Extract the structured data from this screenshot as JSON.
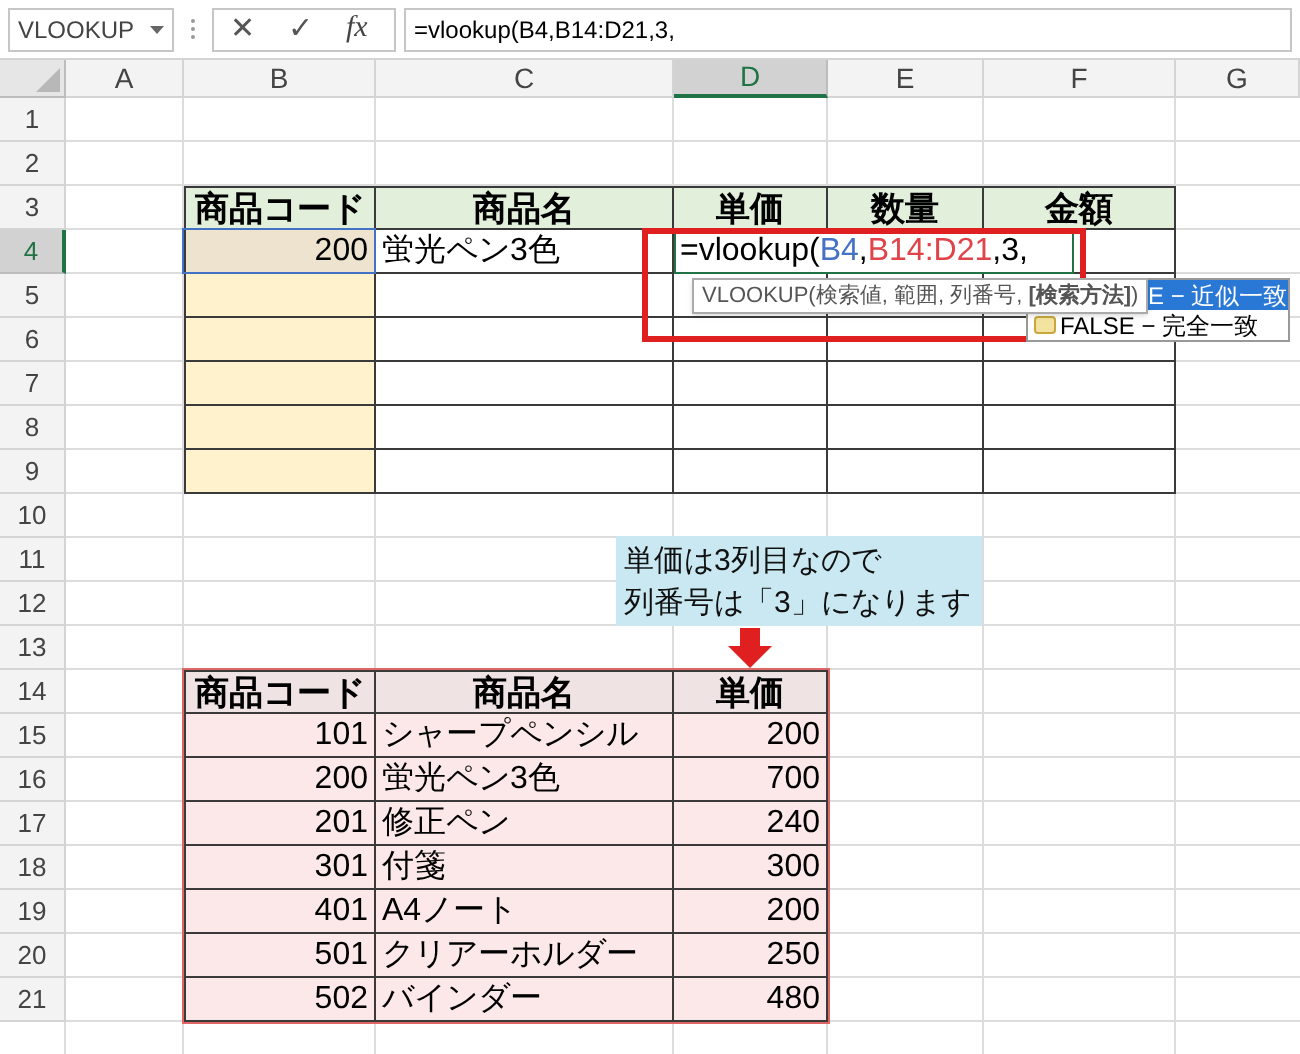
{
  "formula_bar": {
    "name_box": "VLOOKUP",
    "cancel": "✕",
    "enter": "✓",
    "function": "fx",
    "formula": "=vlookup(B4,B14:D21,3,"
  },
  "columns": [
    {
      "label": "A",
      "selected": false
    },
    {
      "label": "B",
      "selected": false
    },
    {
      "label": "C",
      "selected": false
    },
    {
      "label": "D",
      "selected": true
    },
    {
      "label": "E",
      "selected": false
    },
    {
      "label": "F",
      "selected": false
    },
    {
      "label": "G",
      "selected": false
    }
  ],
  "rows": [
    {
      "label": "1",
      "selected": false
    },
    {
      "label": "2",
      "selected": false
    },
    {
      "label": "3",
      "selected": false
    },
    {
      "label": "4",
      "selected": true
    },
    {
      "label": "5",
      "selected": false
    },
    {
      "label": "6",
      "selected": false
    },
    {
      "label": "7",
      "selected": false
    },
    {
      "label": "8",
      "selected": false
    },
    {
      "label": "9",
      "selected": false
    },
    {
      "label": "10",
      "selected": false
    },
    {
      "label": "11",
      "selected": false
    },
    {
      "label": "12",
      "selected": false
    },
    {
      "label": "13",
      "selected": false
    },
    {
      "label": "14",
      "selected": false
    },
    {
      "label": "15",
      "selected": false
    },
    {
      "label": "16",
      "selected": false
    },
    {
      "label": "17",
      "selected": false
    },
    {
      "label": "18",
      "selected": false
    },
    {
      "label": "19",
      "selected": false
    },
    {
      "label": "20",
      "selected": false
    },
    {
      "label": "21",
      "selected": false
    }
  ],
  "order_table": {
    "headers": [
      "商品コード",
      "商品名",
      "単価",
      "数量",
      "金額"
    ],
    "entry": {
      "code": "200",
      "name": "蛍光ペン3色"
    }
  },
  "cell_editor": {
    "parts": [
      {
        "text": "=vlookup(",
        "color": "#000000"
      },
      {
        "text": "B4",
        "color": "#4472c4"
      },
      {
        "text": ",",
        "color": "#000000"
      },
      {
        "text": "B14:D21",
        "color": "#e0444a"
      },
      {
        "text": ",3,",
        "color": "#000000"
      }
    ]
  },
  "tooltip": "VLOOKUP(検索値, 範囲, 列番号, **[検索方法]**)",
  "autocomplete": [
    {
      "label": "E − 近似一致",
      "selected": true
    },
    {
      "label": "FALSE − 完全一致",
      "selected": false
    }
  ],
  "callout": [
    "単価は3列目なので",
    "列番号は「3」になります"
  ],
  "lookup_table": {
    "headers": [
      "商品コード",
      "商品名",
      "単価"
    ],
    "rows": [
      [
        "101",
        "シャープペンシル",
        "200"
      ],
      [
        "200",
        "蛍光ペン3色",
        "700"
      ],
      [
        "201",
        "修正ペン",
        "240"
      ],
      [
        "301",
        "付箋",
        "300"
      ],
      [
        "401",
        "A4ノート",
        "200"
      ],
      [
        "501",
        "クリアーホルダー",
        "250"
      ],
      [
        "502",
        "バインダー",
        "480"
      ]
    ]
  }
}
